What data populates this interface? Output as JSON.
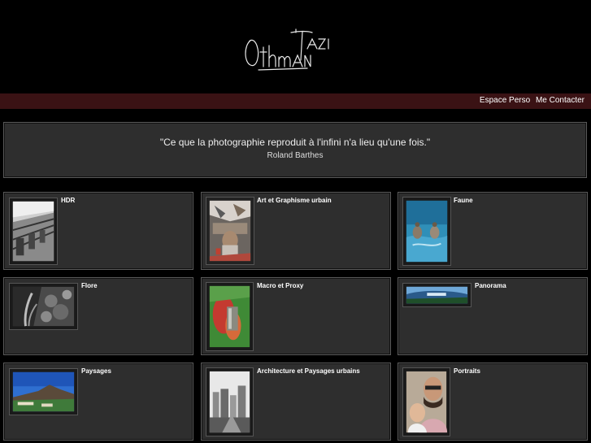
{
  "header": {
    "logo_text": "Othman Tazi"
  },
  "nav": {
    "items": [
      {
        "label": "Espace Perso"
      },
      {
        "label": "Me Contacter"
      }
    ]
  },
  "quote": {
    "text": "\"Ce que la photographie reproduit à l'infini n'a lieu qu'une fois.\"",
    "author": "Roland Barthes"
  },
  "galleries": [
    {
      "title": "HDR",
      "thumb": "hdr-thumbnail"
    },
    {
      "title": "Art et Graphisme urbain",
      "thumb": "urban-art-thumbnail"
    },
    {
      "title": "Faune",
      "thumb": "fauna-thumbnail"
    },
    {
      "title": "Flore",
      "thumb": "flora-thumbnail"
    },
    {
      "title": "Macro et Proxy",
      "thumb": "macro-thumbnail"
    },
    {
      "title": "Panorama",
      "thumb": "panorama-thumbnail"
    },
    {
      "title": "Paysages",
      "thumb": "landscape-thumbnail"
    },
    {
      "title": "Architecture et Paysages urbains",
      "thumb": "architecture-thumbnail"
    },
    {
      "title": "Portraits",
      "thumb": "portrait-thumbnail"
    }
  ]
}
